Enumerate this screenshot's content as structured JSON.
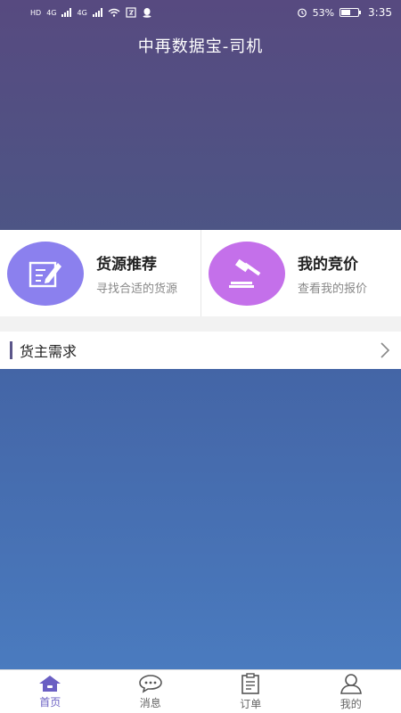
{
  "status_bar": {
    "hd1": "HD",
    "hd2": "HD",
    "net1": "4G",
    "net2": "4G",
    "battery_pct": "53%",
    "time": "3:35"
  },
  "header": {
    "title": "中再数据宝-司机"
  },
  "cards": [
    {
      "title": "货源推荐",
      "subtitle": "寻找合适的货源"
    },
    {
      "title": "我的竞价",
      "subtitle": "查看我的报价"
    }
  ],
  "section": {
    "title": "货主需求"
  },
  "tabs": [
    {
      "label": "首页",
      "icon": "home-icon",
      "active": true
    },
    {
      "label": "消息",
      "icon": "chat-icon",
      "active": false
    },
    {
      "label": "订单",
      "icon": "clipboard-icon",
      "active": false
    },
    {
      "label": "我的",
      "icon": "user-icon",
      "active": false
    }
  ],
  "colors": {
    "header": "#574a80",
    "accent": "#6a5fc3",
    "card_icon_1": "#8b80ee",
    "card_icon_2": "#c470ea",
    "content": "#4a7bbf"
  }
}
